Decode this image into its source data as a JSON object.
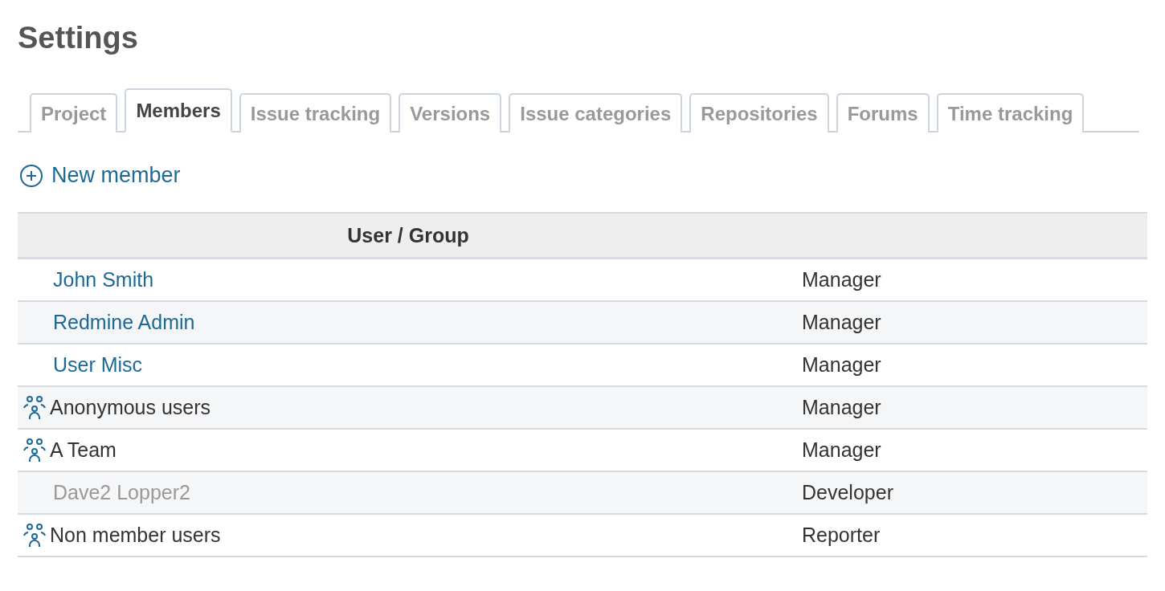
{
  "page": {
    "title": "Settings"
  },
  "tabs": [
    {
      "label": "Project",
      "selected": false
    },
    {
      "label": "Members",
      "selected": true
    },
    {
      "label": "Issue tracking",
      "selected": false
    },
    {
      "label": "Versions",
      "selected": false
    },
    {
      "label": "Issue categories",
      "selected": false
    },
    {
      "label": "Repositories",
      "selected": false
    },
    {
      "label": "Forums",
      "selected": false
    },
    {
      "label": "Time tracking",
      "selected": false
    }
  ],
  "new_member_link": {
    "label": "New member"
  },
  "table": {
    "columns": [
      "User / Group"
    ],
    "rows": [
      {
        "kind": "user",
        "name": "John Smith",
        "roles": "Manager"
      },
      {
        "kind": "user",
        "name": "Redmine Admin",
        "roles": "Manager"
      },
      {
        "kind": "user",
        "name": "User Misc",
        "roles": "Manager"
      },
      {
        "kind": "group",
        "name": "Anonymous users",
        "roles": "Manager"
      },
      {
        "kind": "group",
        "name": "A Team",
        "roles": "Manager"
      },
      {
        "kind": "locked_user",
        "name": "Dave2 Lopper2",
        "roles": "Developer"
      },
      {
        "kind": "group",
        "name": "Non member users",
        "roles": "Reporter"
      }
    ]
  }
}
